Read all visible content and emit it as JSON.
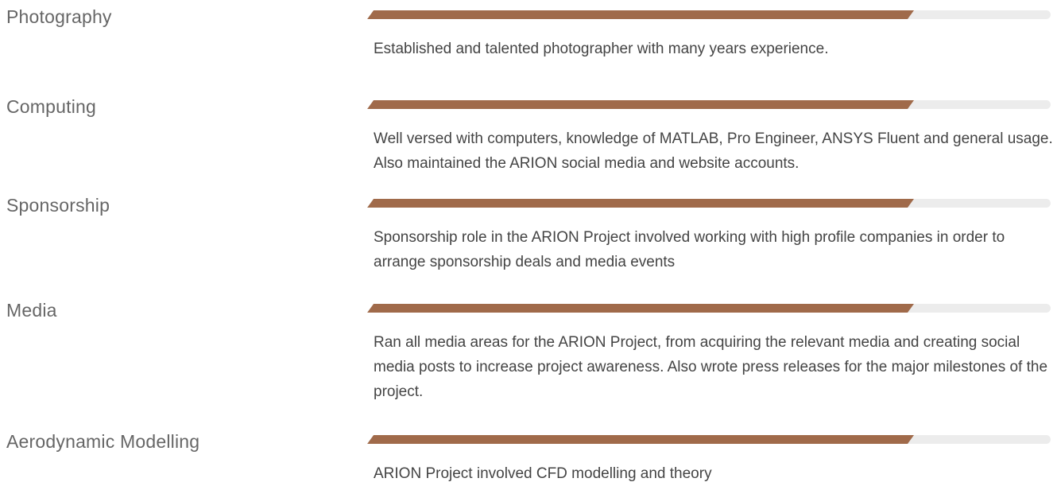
{
  "skills": [
    {
      "name": "Photography",
      "level": 0.8,
      "description": "Established and talented photographer with many years experience."
    },
    {
      "name": "Computing",
      "level": 0.8,
      "description": "Well versed with computers, knowledge of MATLAB, Pro Engineer, ANSYS Fluent and general usage. Also maintained the ARION social media and website accounts."
    },
    {
      "name": "Sponsorship",
      "level": 0.8,
      "description": "Sponsorship role in the ARION Project involved working with high profile companies in order to arrange sponsorship deals and media events"
    },
    {
      "name": "Media",
      "level": 0.8,
      "description": "Ran all media areas for the ARION Project, from acquiring the relevant media and creating social media posts to increase project awareness. Also wrote press releases for the major milestones of the project."
    },
    {
      "name": "Aerodynamic Modelling",
      "level": 0.8,
      "description": "ARION Project involved CFD modelling and theory"
    }
  ],
  "colors": {
    "bar_fill": "#a06a4a",
    "bar_track": "#ececec",
    "skill_name": "#666666",
    "description": "#444444"
  }
}
